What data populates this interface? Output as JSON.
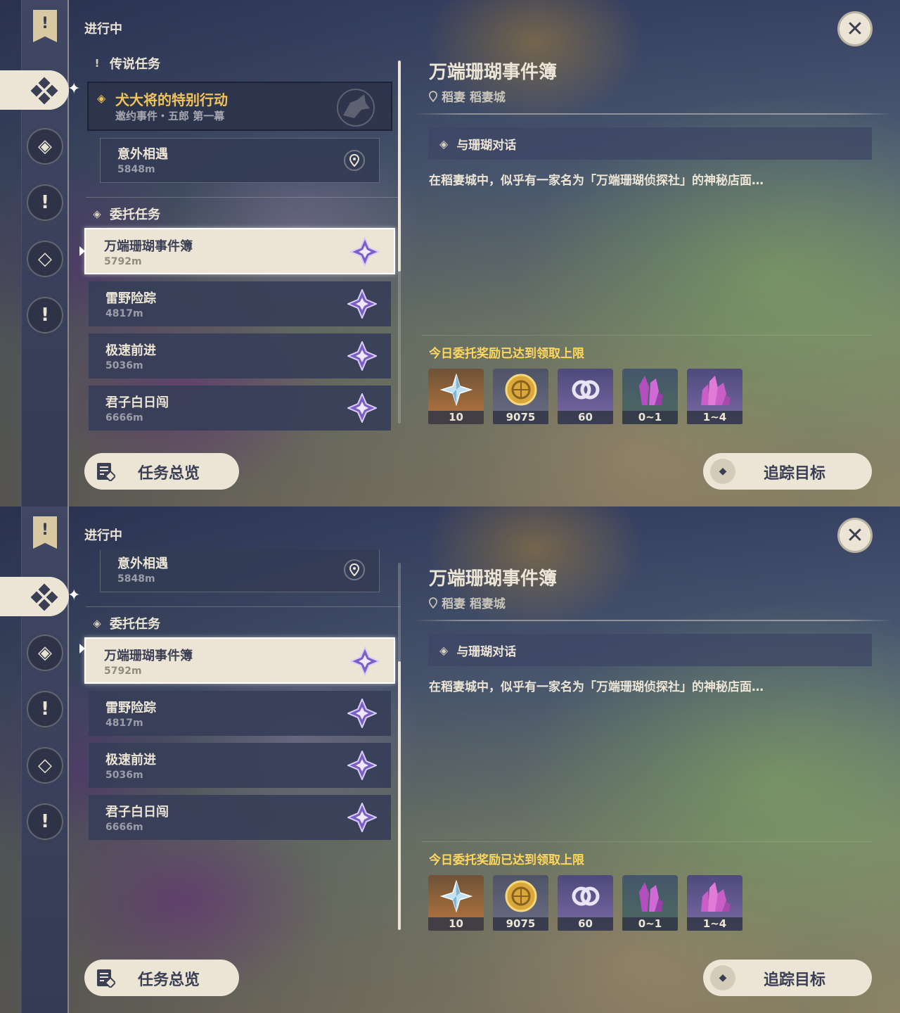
{
  "header": {
    "progress_label": "进行中",
    "close_icon": "close-icon"
  },
  "sidebar": {
    "icons": [
      "banner-icon",
      "commission-icon",
      "world-quest-icon",
      "story-quest-icon",
      "event-icon",
      "exclamation-icon"
    ]
  },
  "legend_section": {
    "label": "传说任务",
    "quest": {
      "title": "犬大将的特别行动",
      "subtitle": "邀约事件・五郎 第一幕"
    },
    "step": {
      "title": "意外相遇",
      "distance": "5848m"
    }
  },
  "commission_section": {
    "label": "委托任务",
    "quests": [
      {
        "title": "万端珊瑚事件簿",
        "distance": "5792m",
        "active": true
      },
      {
        "title": "雷野险踪",
        "distance": "4817m",
        "active": false
      },
      {
        "title": "极速前进",
        "distance": "5036m",
        "active": false
      },
      {
        "title": "君子白日闯",
        "distance": "6666m",
        "active": false
      }
    ]
  },
  "detail": {
    "title": "万端珊瑚事件簿",
    "location": "稻妻 稻妻城",
    "objective": "与珊瑚对话",
    "description": "在稻妻城中，似乎有一家名为「万端珊瑚侦探社」的神秘店面…",
    "reward_note": "今日委托奖励已达到领取上限",
    "rewards": [
      {
        "icon": "primogem-icon",
        "count": "10"
      },
      {
        "icon": "mora-icon",
        "count": "9075"
      },
      {
        "icon": "companionship-exp-icon",
        "count": "60"
      },
      {
        "icon": "ore-crystal-icon",
        "count": "0~1"
      },
      {
        "icon": "ore-crystal-large-icon",
        "count": "1~4"
      }
    ]
  },
  "buttons": {
    "overview": "任务总览",
    "track": "追踪目标"
  },
  "colors": {
    "accent_gold": "#f0c35a",
    "reward_note": "#ffd75a",
    "cream": "#ece5d6",
    "card_dark": "#373e58"
  }
}
